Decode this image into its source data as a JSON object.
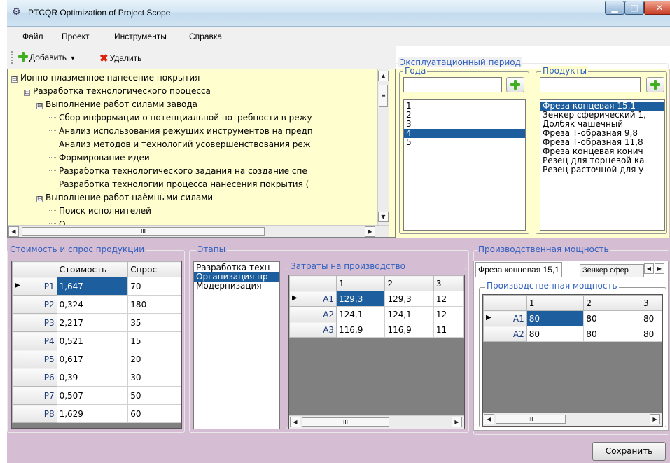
{
  "window": {
    "title": "PTCQR Optimization of Project Scope",
    "min": "▁",
    "max": "□",
    "close": "✕"
  },
  "menu": [
    "Файл",
    "Проект",
    "Инструменты",
    "Справка"
  ],
  "toolbar": {
    "add_label": "Добавить",
    "delete_label": "Удалить",
    "dropdown": "▾"
  },
  "tree": {
    "items": [
      {
        "level": 0,
        "toggle": "⊟",
        "label": "Ионно-плазменное нанесение покрытия"
      },
      {
        "level": 1,
        "toggle": "⊟",
        "label": "Разработка технологического процесса"
      },
      {
        "level": 2,
        "toggle": "⊟",
        "label": "Выполнение работ силами завода"
      },
      {
        "level": 3,
        "toggle": "",
        "label": "Сбор информации о потенциальной потребности в режу"
      },
      {
        "level": 3,
        "toggle": "",
        "label": "Анализ использования режущих инструментов на предп"
      },
      {
        "level": 3,
        "toggle": "",
        "label": "Анализ методов и технологий усовершенствования реж"
      },
      {
        "level": 3,
        "toggle": "",
        "label": "Формирование идеи"
      },
      {
        "level": 3,
        "toggle": "",
        "label": "Разработка технологического задания на создание спе"
      },
      {
        "level": 3,
        "toggle": "",
        "label": "Разработка технологии процесса нанесения покрытия ("
      },
      {
        "level": 2,
        "toggle": "⊟",
        "label": "Выполнение работ наёмными силами"
      },
      {
        "level": 3,
        "toggle": "",
        "label": "Поиск исполнителей"
      },
      {
        "level": 3,
        "toggle": "",
        "label": "О"
      }
    ],
    "scroll_grip": "III"
  },
  "operational_period": {
    "legend": "Эксплуатационный период",
    "years": {
      "legend": "Года",
      "input_value": "",
      "items": [
        "1",
        "2",
        "3",
        "4",
        "5"
      ],
      "selected": "4"
    },
    "products": {
      "legend": "Продукты",
      "input_value": "",
      "items": [
        "Фреза концевая 15,1",
        "Зенкер сферический 1,",
        "Долбяк чашечный",
        "Фреза Т-образная 9,8",
        "Фреза Т-образная 11,8",
        "Фреза концевая конич",
        "Резец для торцевой ка",
        "Резец расточной для у"
      ],
      "selected": "Фреза концевая 15,1"
    }
  },
  "cost_demand": {
    "legend": "Стоимость и спрос продукции",
    "headers": [
      "Стоимость",
      "Спрос"
    ],
    "rows": [
      {
        "id": "P1",
        "cost": "1,647",
        "demand": "70"
      },
      {
        "id": "P2",
        "cost": "0,324",
        "demand": "180"
      },
      {
        "id": "P3",
        "cost": "2,217",
        "demand": "35"
      },
      {
        "id": "P4",
        "cost": "0,521",
        "demand": "15"
      },
      {
        "id": "P5",
        "cost": "0,617",
        "demand": "20"
      },
      {
        "id": "P6",
        "cost": "0,39",
        "demand": "30"
      },
      {
        "id": "P7",
        "cost": "0,507",
        "demand": "50"
      },
      {
        "id": "P8",
        "cost": "1,629",
        "demand": "60"
      }
    ],
    "current_row_marker": "▶"
  },
  "stages": {
    "legend": "Этапы",
    "items": [
      "Разработка техн",
      "Организация пр",
      "Модернизация"
    ],
    "selected": "Организация пр"
  },
  "production_costs": {
    "legend": "Затраты на производство",
    "headers": [
      "1",
      "2",
      "3"
    ],
    "rows": [
      {
        "id": "A1",
        "v": [
          "129,3",
          "129,3",
          "12"
        ]
      },
      {
        "id": "A2",
        "v": [
          "124,1",
          "124,1",
          "12"
        ]
      },
      {
        "id": "A3",
        "v": [
          "116,9",
          "116,9",
          "11"
        ]
      }
    ],
    "scroll_grip": "III"
  },
  "capacity": {
    "legend": "Производственная мощность",
    "tabs": [
      "Фреза концевая 15,1",
      "Зенкер сфер"
    ],
    "inner_legend": "Производственная мощность",
    "headers": [
      "1",
      "2",
      "3"
    ],
    "rows": [
      {
        "id": "A1",
        "v": [
          "80",
          "80",
          "80"
        ]
      },
      {
        "id": "A2",
        "v": [
          "80",
          "80",
          "80"
        ]
      }
    ],
    "scroll_grip": "III"
  },
  "save_label": "Сохранить",
  "colors": {
    "accent": "#1d5e9e",
    "legend": "#2f5fbf",
    "background": "#d5bdd3",
    "tree_bg": "#fefecf"
  }
}
